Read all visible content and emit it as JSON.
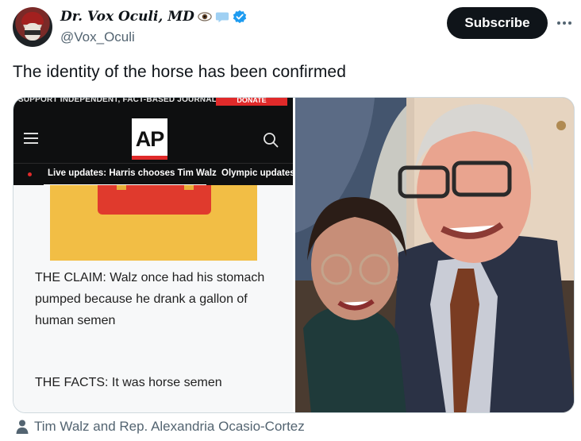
{
  "author": {
    "display_name": "Dr. Vox Oculi, MD",
    "handle": "@Vox_Oculi",
    "emoji_icons": [
      "eye-icon",
      "speech-bubble-icon"
    ],
    "verified": true,
    "accent_color": "#1d9bf0"
  },
  "actions": {
    "subscribe_label": "Subscribe",
    "more_icon": "more-dots-icon"
  },
  "tweet": {
    "text": "The identity of the horse has been confirmed"
  },
  "media": {
    "left_image": {
      "support_banner": "SUPPORT INDEPENDENT, FACT-BASED JOURNALISM.",
      "donate_label": "DONATE",
      "logo_text": "AP",
      "nav_live": "Live updates: Harris chooses Tim Walz",
      "nav_next": "Olympic updates",
      "claim_text": "THE CLAIM: Walz once had his stomach pumped because he drank a gallon of human semen",
      "facts_text": "THE FACTS: It was horse semen"
    },
    "right_image": {
      "description_icon": "photo"
    }
  },
  "caption": {
    "icon": "person-icon",
    "text": "Tim Walz and Rep. Alexandria Ocasio-Cortez"
  }
}
